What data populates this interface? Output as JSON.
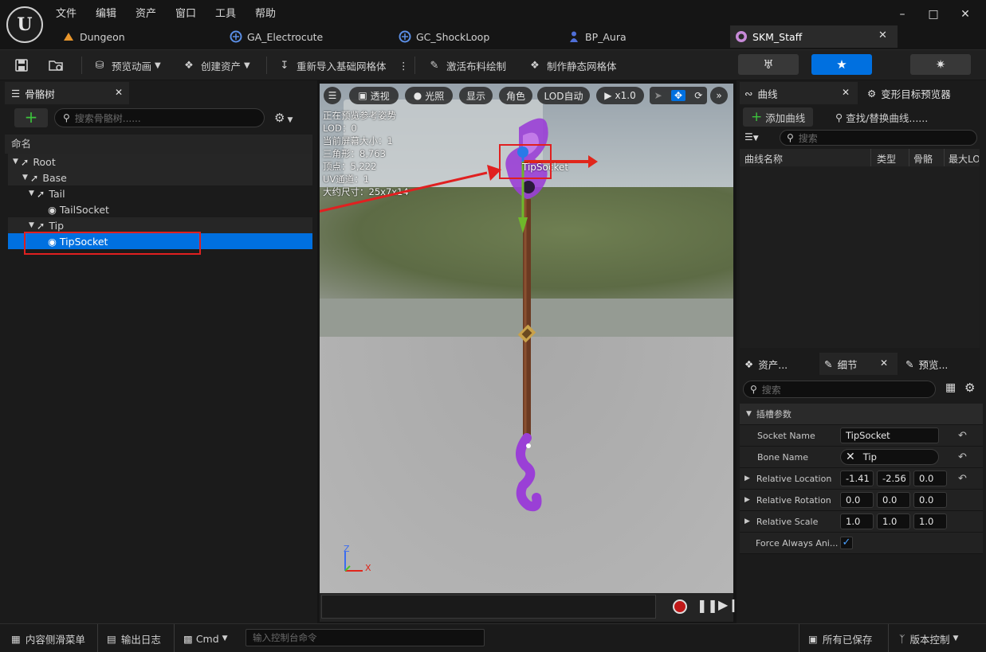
{
  "menu": [
    "文件",
    "编辑",
    "资产",
    "窗口",
    "工具",
    "帮助"
  ],
  "tabs": [
    {
      "label": "Dungeon",
      "icon": "level-icon"
    },
    {
      "label": "GA_Electrocute",
      "icon": "blueprint-icon"
    },
    {
      "label": "GC_ShockLoop",
      "icon": "blueprint-icon"
    },
    {
      "label": "BP_Aura",
      "icon": "character-icon"
    },
    {
      "label": "SKM_Staff",
      "icon": "skeletal-mesh-icon"
    }
  ],
  "toolbar": {
    "preview_anim": "预览动画",
    "create_asset": "创建资产",
    "reimport": "重新导入基础网格体",
    "activate_cloth": "激活布料绘制",
    "make_static": "制作静态网格体"
  },
  "skeleton_tree": {
    "tab_label": "骨骼树",
    "search_placeholder": "搜索骨骼树......",
    "column_name": "命名",
    "rows": [
      {
        "label": "Root",
        "depth": 0,
        "kind": "bone"
      },
      {
        "label": "Base",
        "depth": 1,
        "kind": "bone"
      },
      {
        "label": "Tail",
        "depth": 2,
        "kind": "bone"
      },
      {
        "label": "TailSocket",
        "depth": 3,
        "kind": "socket"
      },
      {
        "label": "Tip",
        "depth": 2,
        "kind": "bone"
      },
      {
        "label": "TipSocket",
        "depth": 3,
        "kind": "socket"
      }
    ]
  },
  "viewport": {
    "buttons": {
      "perspective": "透视",
      "lit": "光照",
      "show": "显示",
      "character": "角色",
      "lod": "LOD自动",
      "play_speed": "x1.0"
    },
    "stats": [
      "正在预览参考姿势",
      "LOD：0",
      "当前屏幕大小：1",
      "三角形：8,763",
      "顶点：5,222",
      "UV通道：1",
      "大约尺寸：25x7x14"
    ],
    "socket_label": "TipSocket",
    "axis_x": "X",
    "axis_z": "Z"
  },
  "curves": {
    "tab_label": "曲线",
    "morph_tab_label": "变形目标预览器",
    "add_curve": "添加曲线",
    "find_replace": "查找/替换曲线......",
    "search_placeholder": "搜索",
    "columns": [
      "曲线名称",
      "类型",
      "骨骼",
      "最大LOD"
    ]
  },
  "details": {
    "tabs": [
      "资产...",
      "细节",
      "预览..."
    ],
    "search_placeholder": "搜索",
    "section": "插槽参数",
    "socket_name_label": "Socket Name",
    "socket_name_value": "TipSocket",
    "bone_name_label": "Bone Name",
    "bone_name_value": "Tip",
    "location_label": "Relative Location",
    "location": [
      "-1.41",
      "-2.56",
      "0.0"
    ],
    "rotation_label": "Relative Rotation",
    "rotation": [
      "0.0",
      "0.0",
      "0.0"
    ],
    "scale_label": "Relative Scale",
    "scale": [
      "1.0",
      "1.0",
      "1.0"
    ],
    "force_label": "Force Always Ani...",
    "force_checked": true
  },
  "bottom": {
    "content_drawer": "内容侧滑菜单",
    "output_log": "输出日志",
    "cmd": "Cmd",
    "console_placeholder": "输入控制台命令",
    "all_saved": "所有已保存",
    "source_control": "版本控制"
  },
  "colors": {
    "accent": "#0070e0",
    "highlight_box": "#e02020",
    "add_green": "#3cc33c"
  }
}
